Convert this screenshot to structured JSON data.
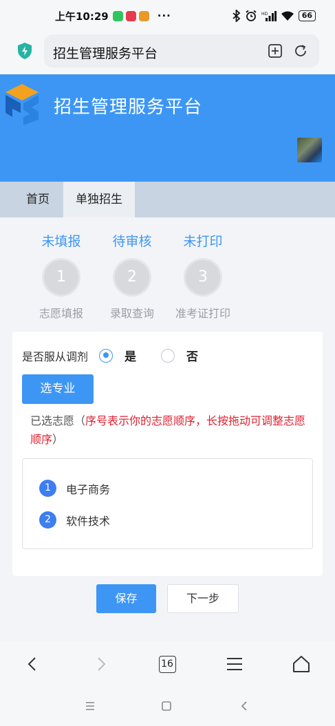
{
  "status_bar": {
    "time": "上午10:29",
    "dots": "···",
    "battery": "66"
  },
  "browser": {
    "url_title": "招生管理服务平台",
    "tab_count": "16"
  },
  "header": {
    "title": "招生管理服务平台"
  },
  "tabs": [
    {
      "label": "首页"
    },
    {
      "label": "单独招生"
    }
  ],
  "steps": [
    {
      "status": "未填报",
      "number": "1",
      "label": "志愿填报"
    },
    {
      "status": "待审核",
      "number": "2",
      "label": "录取查询"
    },
    {
      "status": "未打印",
      "number": "3",
      "label": "准考证打印"
    }
  ],
  "form": {
    "obey_label": "是否服从调剂",
    "option_yes": "是",
    "option_no": "否",
    "selected_option": "是",
    "select_major_button": "选专业",
    "hint_prefix": "已选志愿（",
    "hint_red": "序号表示你的志愿顺序，长按拖动可调整志愿顺序",
    "hint_suffix": "）",
    "choices": [
      {
        "num": "1",
        "name": "电子商务"
      },
      {
        "num": "2",
        "name": "软件技术"
      }
    ]
  },
  "actions": {
    "save": "保存",
    "next": "下一步"
  },
  "colors": {
    "primary": "#3d96f4",
    "hint_red": "#e0202f"
  }
}
